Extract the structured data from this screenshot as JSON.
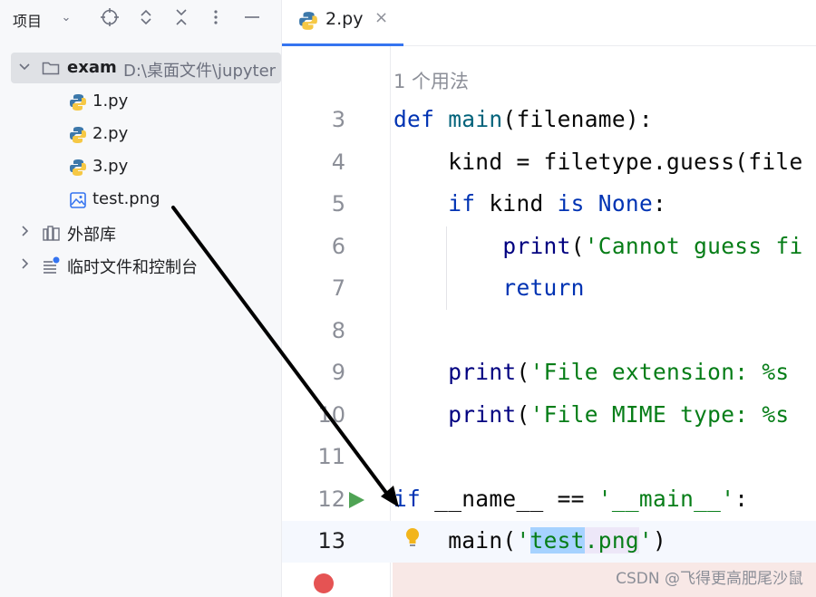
{
  "sidebar": {
    "title": "项目",
    "tree": {
      "root": {
        "name": "exam",
        "path": "D:\\桌面文件\\jupyter"
      },
      "files": [
        {
          "name": "1.py",
          "icon": "python-file-icon"
        },
        {
          "name": "2.py",
          "icon": "python-file-icon"
        },
        {
          "name": "3.py",
          "icon": "python-file-icon"
        },
        {
          "name": "test.png",
          "icon": "image-file-icon"
        }
      ],
      "external_libraries": "外部库",
      "scratches": "临时文件和控制台"
    }
  },
  "editor": {
    "tab": {
      "label": "2.py",
      "close": "×"
    },
    "usage_hint": "1 个用法",
    "line_numbers": [
      "3",
      "4",
      "5",
      "6",
      "7",
      "8",
      "9",
      "10",
      "11",
      "12",
      "13"
    ]
  },
  "colors": {
    "keyword": "#0033b3",
    "function": "#00627a",
    "string": "#067d17",
    "accent": "#3574f0",
    "run": "#4fa354",
    "breakpoint": "#e55353"
  },
  "watermark": "CSDN @飞得更高肥尾沙鼠"
}
